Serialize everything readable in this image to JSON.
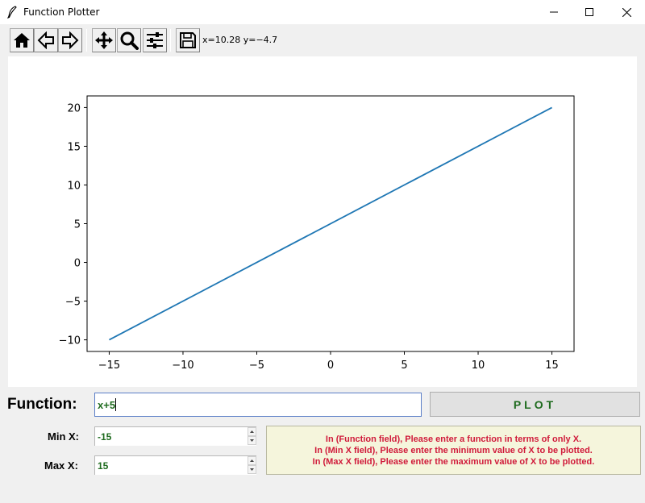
{
  "window": {
    "title": "Function Plotter",
    "controls": [
      "minimize",
      "maximize",
      "close"
    ]
  },
  "toolbar": {
    "buttons": [
      {
        "name": "home",
        "icon": "home-icon"
      },
      {
        "name": "back",
        "icon": "arrow-left-icon"
      },
      {
        "name": "forward",
        "icon": "arrow-right-icon"
      },
      {
        "name": "pan",
        "icon": "move-icon"
      },
      {
        "name": "zoom",
        "icon": "magnifier-icon"
      },
      {
        "name": "configure-subplots",
        "icon": "sliders-icon"
      },
      {
        "name": "save",
        "icon": "floppy-disk-icon"
      }
    ],
    "coords_text": "x=10.28 y=−4.7"
  },
  "chart_data": {
    "type": "line",
    "title": "",
    "xlabel": "",
    "ylabel": "",
    "xlim": [
      -16.5,
      16.5
    ],
    "ylim": [
      -11.5,
      21.5
    ],
    "xticks": [
      -15,
      -10,
      -5,
      0,
      5,
      10,
      15
    ],
    "yticks": [
      -10,
      -5,
      0,
      5,
      10,
      15,
      20
    ],
    "grid": false,
    "legend": "none",
    "series": [
      {
        "color": "#1f77b4",
        "x": [
          -15,
          15
        ],
        "y": [
          -10,
          20
        ]
      }
    ]
  },
  "form": {
    "function_label": "Function:",
    "function_value": "x+5",
    "plot_button": "PLOT",
    "min_x_label": "Min X:",
    "min_x_value": "-15",
    "max_x_label": "Max X:",
    "max_x_value": "15",
    "info_lines": [
      "In (Function field), Please enter a function in terms of only X.",
      "In (Min X field), Please enter the minimum value of X to be plotted.",
      "In (Max X field), Please enter the maximum value of X to be plotted."
    ]
  },
  "colors": {
    "input_text": "#1e6b1e",
    "info_text": "#d01a3a",
    "info_background": "#f5f5dc",
    "line": "#1f77b4"
  }
}
